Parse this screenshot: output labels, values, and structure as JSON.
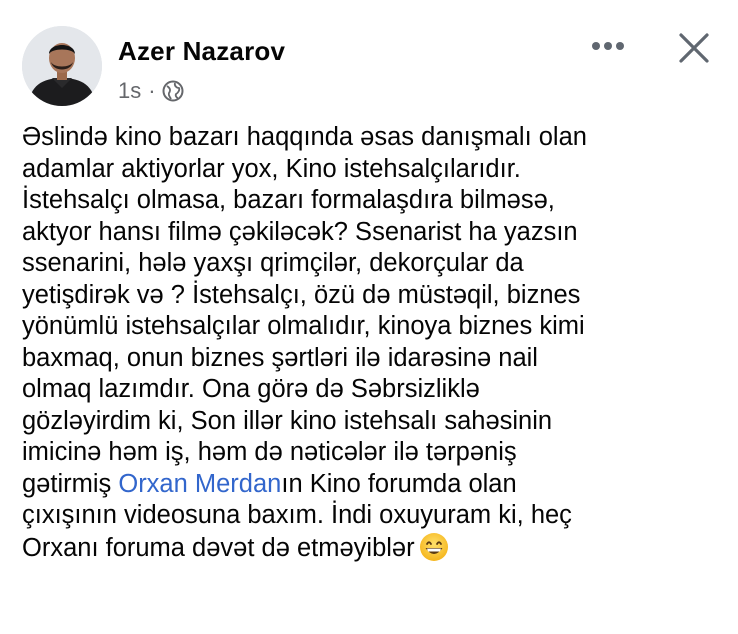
{
  "post": {
    "author_name": "Azer Nazarov",
    "timestamp": "1s",
    "separator": "·",
    "privacy_icon": "globe-icon",
    "more_icon": "more-horizontal-icon",
    "close_icon": "close-icon",
    "body": {
      "text_before_link": "Əslində kino bazarı haqqında əsas danışmalı olan\nadamlar aktiyorlar yox, Kino istehsalçılarıdır.\nİstehsalçı olmasa, bazarı formalaşdıra bilməsə,\naktyor hansı filmə çəkiləcək? Ssenarist ha yazsın\nssenarini, hələ yaxşı qrimçilər, dekorçular da\nyetişdirək və ? İstehsalçı, özü də müstəqil, biznes\nyönümlü istehsalçılar olmalıdır, kinoya biznes kimi\nbaxmaq, onun biznes şərtləri ilə idarəsinə nail\nolmaq lazımdır. Ona görə də Səbrsizliklə\ngözləyirdim ki, Son illər kino istehsalı sahəsinin\nimicinə həm iş, həm də nəticələr ilə tərpəniş\ngətirmiş ",
      "link_text": "Orxan Merdan",
      "text_after_link": "ın Kino forumda olan\nçıxışının videosuna baxım. İndi oxuyuram ki, heç\nOrxanı foruma dəvət də etməyiblər",
      "emoji": "grinning-face-emoji"
    }
  },
  "colors": {
    "text": "#050505",
    "secondary_text": "#65676b",
    "link": "#3266cc",
    "icon": "#606770"
  }
}
